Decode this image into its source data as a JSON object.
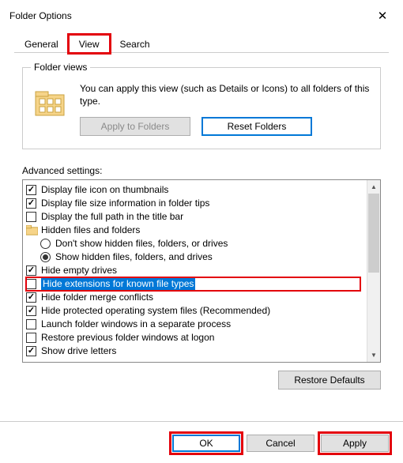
{
  "window": {
    "title": "Folder Options"
  },
  "tabs": {
    "general": "General",
    "view": "View",
    "search": "Search",
    "active": "view"
  },
  "folder_views": {
    "legend": "Folder views",
    "desc": "You can apply this view (such as Details or Icons) to all folders of this type.",
    "apply_btn": "Apply to Folders",
    "reset_btn": "Reset Folders"
  },
  "advanced": {
    "label": "Advanced settings:",
    "items": [
      {
        "kind": "check",
        "checked": true,
        "label": "Display file icon on thumbnails"
      },
      {
        "kind": "check",
        "checked": true,
        "label": "Display file size information in folder tips"
      },
      {
        "kind": "check",
        "checked": false,
        "label": "Display the full path in the title bar"
      },
      {
        "kind": "folder",
        "label": "Hidden files and folders"
      },
      {
        "kind": "radio",
        "checked": false,
        "indent": 1,
        "label": "Don't show hidden files, folders, or drives"
      },
      {
        "kind": "radio",
        "checked": true,
        "indent": 1,
        "label": "Show hidden files, folders, and drives"
      },
      {
        "kind": "check",
        "checked": true,
        "label": "Hide empty drives"
      },
      {
        "kind": "check",
        "checked": false,
        "label": "Hide extensions for known file types",
        "selected": true,
        "red": true
      },
      {
        "kind": "check",
        "checked": true,
        "label": "Hide folder merge conflicts"
      },
      {
        "kind": "check",
        "checked": true,
        "label": "Hide protected operating system files (Recommended)"
      },
      {
        "kind": "check",
        "checked": false,
        "label": "Launch folder windows in a separate process"
      },
      {
        "kind": "check",
        "checked": false,
        "label": "Restore previous folder windows at logon"
      },
      {
        "kind": "check",
        "checked": true,
        "label": "Show drive letters"
      }
    ],
    "restore_btn": "Restore Defaults"
  },
  "footer": {
    "ok": "OK",
    "cancel": "Cancel",
    "apply": "Apply"
  }
}
